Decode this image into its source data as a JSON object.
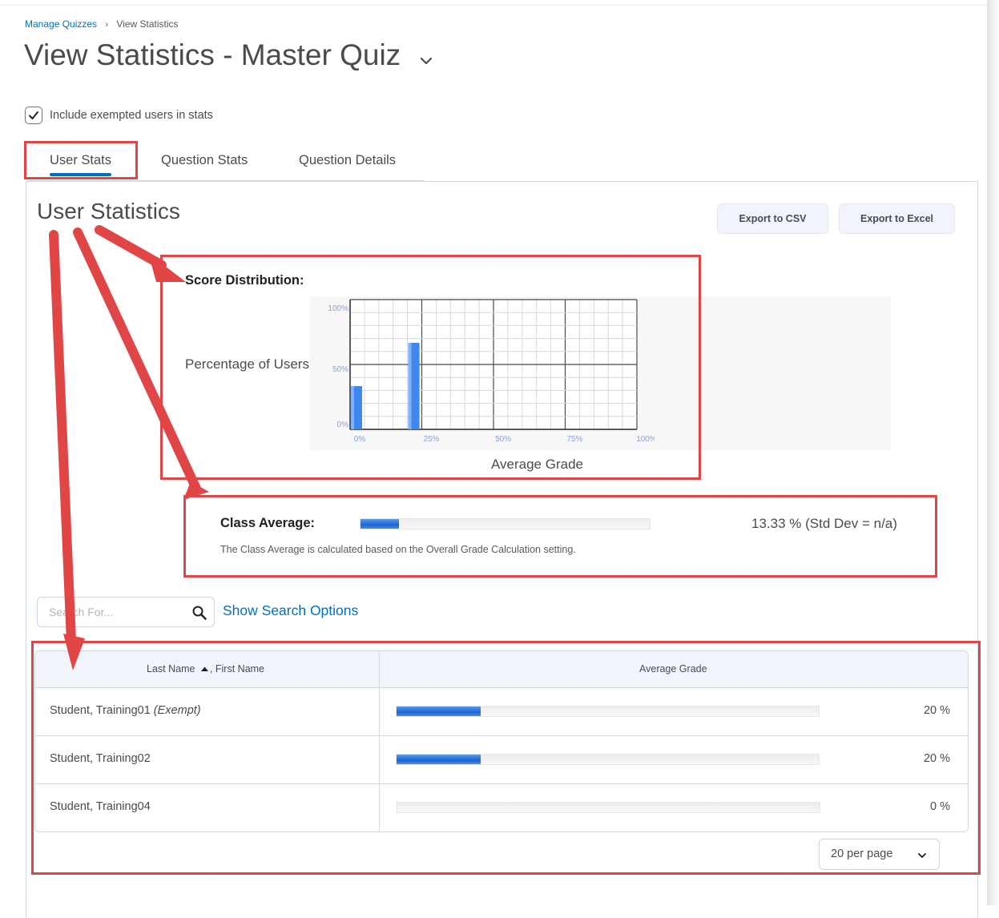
{
  "breadcrumb": {
    "parent": "Manage Quizzes",
    "separator": "›",
    "current": "View Statistics"
  },
  "page": {
    "title": "View Statistics - Master Quiz"
  },
  "exempt": {
    "label": "Include exempted users in stats",
    "checked": true
  },
  "tabs": [
    {
      "label": "User Stats",
      "selected": true
    },
    {
      "label": "Question Stats",
      "selected": false
    },
    {
      "label": "Question Details",
      "selected": false
    }
  ],
  "section": {
    "title": "User Statistics"
  },
  "buttons": {
    "export_csv": "Export to CSV",
    "export_excel": "Export to Excel"
  },
  "score_distribution": {
    "label": "Score Distribution:"
  },
  "chart_data": {
    "type": "bar",
    "title": "",
    "xlabel": "Average Grade",
    "ylabel": "Percentage of Users",
    "x_ticks": [
      "0%",
      "25%",
      "50%",
      "75%",
      "100%"
    ],
    "y_ticks": [
      "0%",
      "50%",
      "100%"
    ],
    "xlim": [
      0,
      100
    ],
    "ylim": [
      0,
      100
    ],
    "bars": [
      {
        "x": 0,
        "value": 33.3
      },
      {
        "x": 20,
        "value": 66.7
      }
    ],
    "grid": true
  },
  "class_average": {
    "label": "Class Average:",
    "percent": 13.33,
    "value_text": "13.33 % (Std Dev = n/a)",
    "note": "The Class Average is calculated based on the Overall Grade Calculation setting."
  },
  "search": {
    "placeholder": "Search For...",
    "show_options": "Show Search Options"
  },
  "table": {
    "headers": {
      "name_last": "Last Name",
      "name_sep": ", ",
      "name_first": "First Name",
      "grade": "Average Grade"
    },
    "rows": [
      {
        "name": "Student, Training01",
        "suffix": "(Exempt)",
        "grade": 20,
        "grade_text": "20 %"
      },
      {
        "name": "Student, Training02",
        "suffix": "",
        "grade": 20,
        "grade_text": "20 %"
      },
      {
        "name": "Student, Training04",
        "suffix": "",
        "grade": 0,
        "grade_text": "0 %"
      }
    ]
  },
  "pagination": {
    "per_page": "20 per page"
  },
  "colors": {
    "accent": "#006fbf",
    "bar": "#1b63d6",
    "annotation": "#e04646"
  }
}
